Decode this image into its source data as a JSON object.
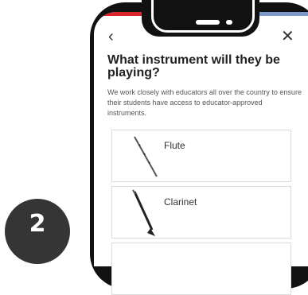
{
  "step": {
    "number": "2"
  },
  "nav": {
    "back_label": "‹",
    "close_label": "✕"
  },
  "page": {
    "title": "What instrument will they be playing?",
    "description": "We work closely with educators all over the country to ensure their students have access to educator-approved instruments."
  },
  "instruments": [
    {
      "name": "Flute",
      "icon": "flute-icon"
    },
    {
      "name": "Clarinet",
      "icon": "clarinet-icon"
    }
  ],
  "colors": {
    "accent_red": "#d8262b",
    "accent_blue": "#7c99c7",
    "badge": "#353535"
  }
}
